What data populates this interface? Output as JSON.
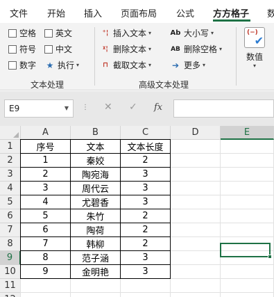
{
  "ribbon_tabs": [
    {
      "label": "文件"
    },
    {
      "label": "开始"
    },
    {
      "label": "插入"
    },
    {
      "label": "页面布局"
    },
    {
      "label": "公式"
    },
    {
      "label": "方方格子",
      "active": true
    },
    {
      "label": "数"
    }
  ],
  "accent_color": "#1e7145",
  "text_group": {
    "label": "文本处理",
    "checkboxes": [
      {
        "label": "空格",
        "checked": false
      },
      {
        "label": "英文",
        "checked": false
      },
      {
        "label": "符号",
        "checked": false
      },
      {
        "label": "中文",
        "checked": false
      },
      {
        "label": "数字",
        "checked": false
      }
    ],
    "execute_label": "执行"
  },
  "advanced_group": {
    "label": "高级文本处理",
    "insert_text": "插入文本",
    "delete_text": "删除文本",
    "extract_text": "截取文本",
    "case_label": "大小写",
    "case_icon": "Ab",
    "delete_space": "删除空格",
    "delete_space_icon": "AB",
    "more_label": "更多"
  },
  "value_button": {
    "label": "数值",
    "icon": "value-check-icon"
  },
  "formula_bar": {
    "name_box": "E9",
    "fx_label": "fx",
    "formula": ""
  },
  "sheet": {
    "columns": [
      "A",
      "B",
      "C",
      "D",
      "E"
    ],
    "row_numbers": [
      "1",
      "2",
      "3",
      "4",
      "5",
      "6",
      "7",
      "8",
      "9",
      "10",
      "11",
      "12"
    ],
    "selected_cell": "E9",
    "table": [
      [
        "序号",
        "文本",
        "文本长度"
      ],
      [
        "1",
        "秦姣",
        "2"
      ],
      [
        "2",
        "陶宛海",
        "3"
      ],
      [
        "3",
        "周代云",
        "3"
      ],
      [
        "4",
        "尤碧香",
        "3"
      ],
      [
        "5",
        "朱竹",
        "2"
      ],
      [
        "6",
        "陶荷",
        "2"
      ],
      [
        "7",
        "韩柳",
        "2"
      ],
      [
        "8",
        "范子涵",
        "3"
      ],
      [
        "9",
        "金明艳",
        "3"
      ]
    ]
  }
}
